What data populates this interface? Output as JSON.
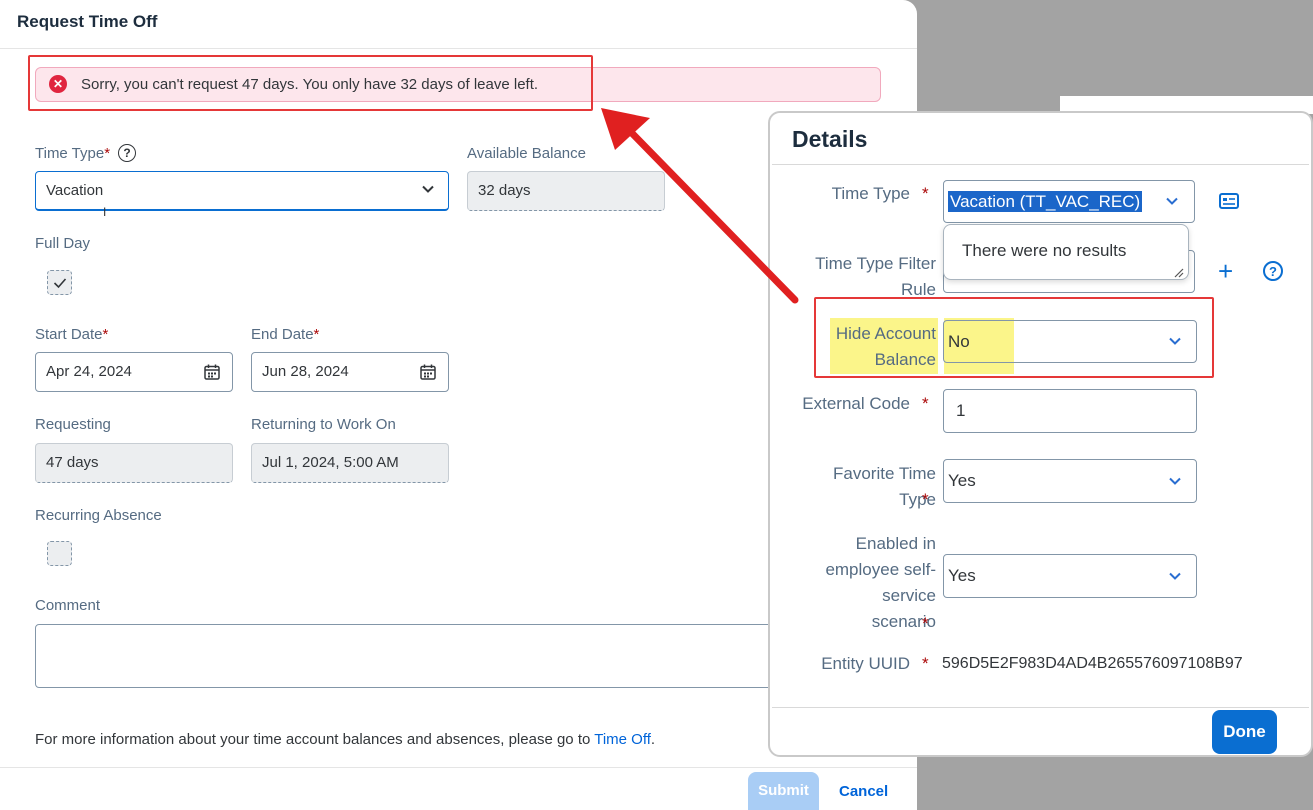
{
  "request_dialog": {
    "title": "Request Time Off",
    "error_message": "Sorry, you can't request 47 days. You only have 32 days of leave left.",
    "time_type": {
      "label": "Time Type",
      "value": "Vacation",
      "required_mark": "*"
    },
    "available_balance": {
      "label": "Available Balance",
      "value": "32 days"
    },
    "full_day": {
      "label": "Full Day",
      "checked": true
    },
    "start_date": {
      "label": "Start Date",
      "value": "Apr 24, 2024",
      "required_mark": "*"
    },
    "end_date": {
      "label": "End Date",
      "value": "Jun 28, 2024",
      "required_mark": "*"
    },
    "requesting": {
      "label": "Requesting",
      "value": "47 days"
    },
    "returning": {
      "label": "Returning to Work On",
      "value": "Jul 1, 2024, 5:00 AM"
    },
    "recurring_absence": {
      "label": "Recurring Absence",
      "checked": false
    },
    "comment": {
      "label": "Comment",
      "value": ""
    },
    "footer_text": "For more information about your time account balances and absences, please go to ",
    "footer_link": "Time Off",
    "footer_period": ".",
    "submit_label": "Submit",
    "cancel_label": "Cancel"
  },
  "details_dialog": {
    "title": "Details",
    "required_mark": "*",
    "time_type": {
      "label": "Time Type",
      "value": "Vacation (TT_VAC_REC)"
    },
    "popover_text": "There were no results",
    "time_type_filter_rule": {
      "label_line1": "Time Type Filter",
      "label_line2": "Rule"
    },
    "hide_account_balance": {
      "label_line1": "Hide Account",
      "label_line2": "Balance",
      "value": "No"
    },
    "external_code": {
      "label": "External Code",
      "value": "1"
    },
    "favorite_time_type": {
      "label_line1": "Favorite Time",
      "label_line2": "Type",
      "value": "Yes"
    },
    "enabled_ess": {
      "label_line1": "Enabled in",
      "label_line2": "employee self-",
      "label_line3": "service",
      "label_line4": "scenario",
      "value": "Yes"
    },
    "entity_uuid": {
      "label": "Entity UUID",
      "value": "596D5E2F983D4AD4B265576097108B97"
    },
    "done_label": "Done"
  },
  "colors": {
    "accent": "#0a6ed1",
    "error": "#e0253f",
    "annotation_red": "#e53838",
    "highlight": "#fbf58a"
  },
  "icons": [
    "error-icon",
    "help-icon",
    "chevron-down-icon",
    "calendar-icon",
    "checkmark-icon",
    "value-help-icon",
    "plus-icon",
    "resize-handle-icon"
  ]
}
